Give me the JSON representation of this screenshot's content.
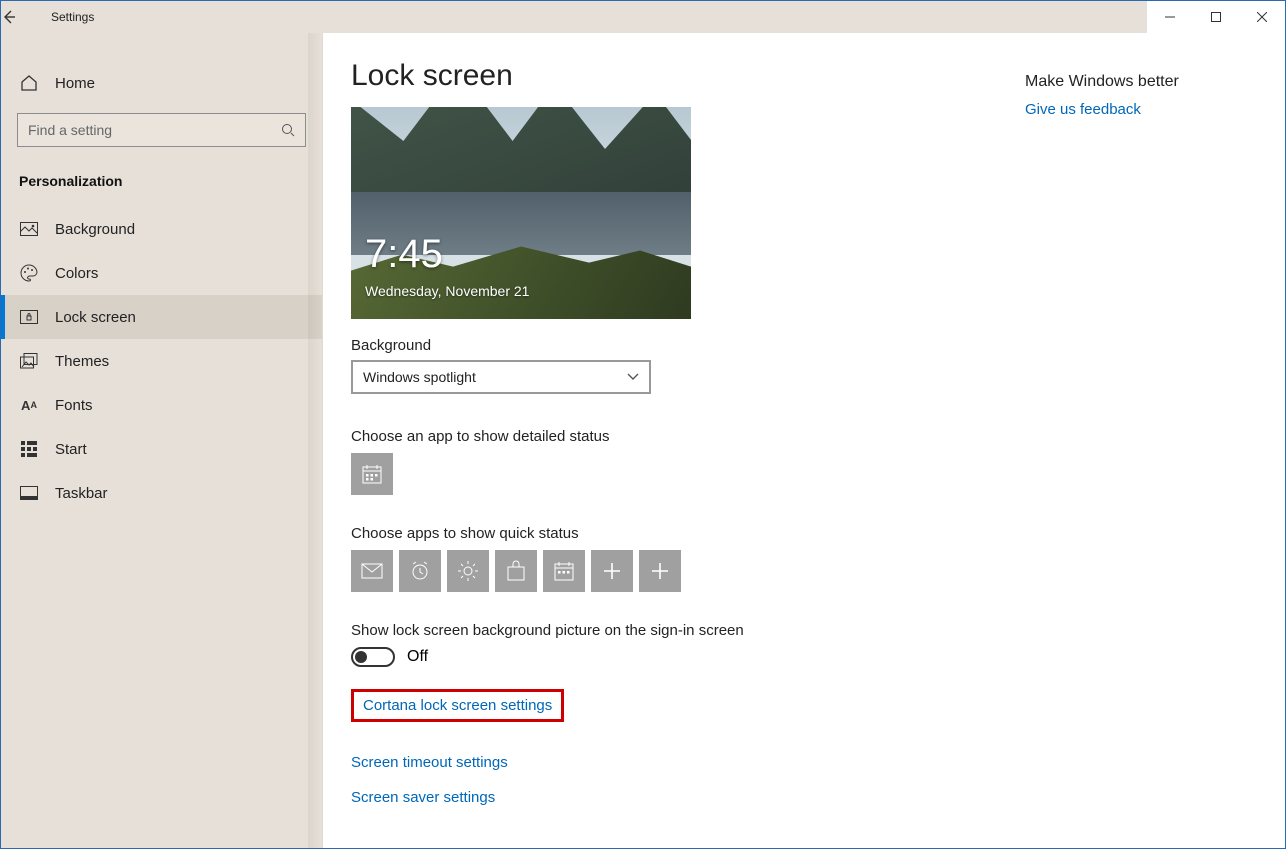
{
  "window": {
    "title": "Settings"
  },
  "sidebar": {
    "home": "Home",
    "search_placeholder": "Find a setting",
    "section": "Personalization",
    "items": [
      {
        "label": "Background"
      },
      {
        "label": "Colors"
      },
      {
        "label": "Lock screen"
      },
      {
        "label": "Themes"
      },
      {
        "label": "Fonts"
      },
      {
        "label": "Start"
      },
      {
        "label": "Taskbar"
      }
    ]
  },
  "page": {
    "title": "Lock screen",
    "preview": {
      "time": "7:45",
      "date": "Wednesday, November 21"
    },
    "background_label": "Background",
    "background_value": "Windows spotlight",
    "detailed_status_label": "Choose an app to show detailed status",
    "quick_status_label": "Choose apps to show quick status",
    "signin_bg_label": "Show lock screen background picture on the sign-in screen",
    "signin_bg_value": "Off",
    "links": {
      "cortana": "Cortana lock screen settings",
      "timeout": "Screen timeout settings",
      "saver": "Screen saver settings"
    }
  },
  "right": {
    "heading": "Make Windows better",
    "feedback": "Give us feedback"
  }
}
